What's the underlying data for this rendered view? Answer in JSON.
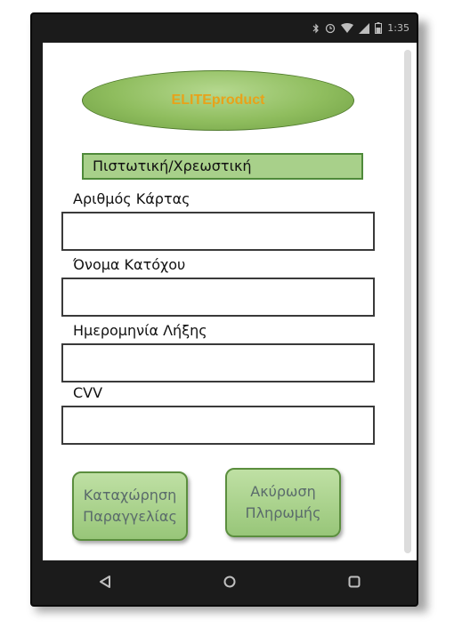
{
  "status_bar": {
    "time": "1:35"
  },
  "logo": {
    "text": "ELITEproduct"
  },
  "payment": {
    "card_type": "Πιστωτική/Χρεωστική",
    "fields": [
      {
        "label": "Αριθμός Κάρτας",
        "value": ""
      },
      {
        "label": "Όνομα Κατόχου",
        "value": ""
      },
      {
        "label": "Ημερομηνία Λήξης",
        "value": ""
      },
      {
        "label": "CVV",
        "value": ""
      }
    ]
  },
  "buttons": {
    "submit_line1": "Καταχώρηση",
    "submit_line2": "Παραγγελίας",
    "cancel_line1": "Ακύρωση",
    "cancel_line2": "Πληρωμής"
  },
  "navigation": {
    "back_icon": "back-triangle-icon",
    "home_icon": "home-circle-icon",
    "recents_icon": "recents-square-icon"
  },
  "colors": {
    "logo_text": "#e8a21a",
    "green_fill": "#a8d08a",
    "green_border": "#4f8a3a"
  }
}
